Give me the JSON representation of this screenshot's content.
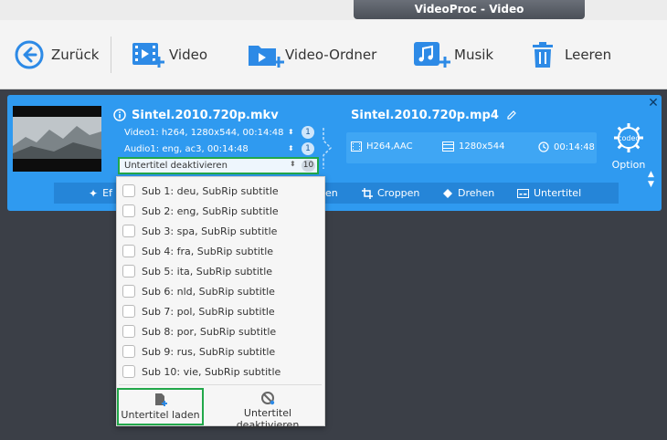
{
  "window": {
    "title": "VideoProc - Video"
  },
  "toolbar": {
    "back": "Zurück",
    "video": "Video",
    "video_folder": "Video-Ordner",
    "music": "Musik",
    "clear": "Leeren"
  },
  "task": {
    "source_file": "Sintel.2010.720p.mkv",
    "video_track": "Video1: h264, 1280x544, 00:14:48",
    "video_count": "1",
    "audio_track": "Audio1: eng, ac3, 00:14:48",
    "audio_count": "1",
    "subtitle_selected": "Untertitel deaktivieren",
    "subtitle_count": "10",
    "output_file": "Sintel.2010.720p.mp4",
    "output_codec": "H264,AAC",
    "output_resolution": "1280x544",
    "output_duration": "00:14:48",
    "codec_badge": "codec",
    "option_label": "Option"
  },
  "editbar": {
    "effect": "Ef",
    "cut_partial": "en",
    "crop": "Croppen",
    "rotate": "Drehen",
    "subtitle": "Untertitel"
  },
  "subtitle_dropdown": {
    "options": [
      "Sub 1: deu, SubRip subtitle",
      "Sub 2: eng, SubRip subtitle",
      "Sub 3: spa, SubRip subtitle",
      "Sub 4: fra, SubRip subtitle",
      "Sub 5: ita, SubRip subtitle",
      "Sub 6: nld, SubRip subtitle",
      "Sub 7: pol, SubRip subtitle",
      "Sub 8: por, SubRip subtitle",
      "Sub 9: rus, SubRip subtitle",
      "Sub 10: vie, SubRip subtitle"
    ],
    "load_button": "Untertitel laden",
    "disable_button": "Untertitel deaktivieren"
  },
  "colors": {
    "accent": "#2f9af0",
    "highlight": "#22a84a",
    "icon_blue": "#2d8ae6",
    "background": "#3b3f47"
  }
}
